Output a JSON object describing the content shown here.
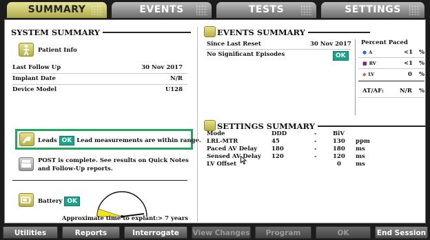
{
  "tabs": [
    {
      "label": "SUMMARY",
      "active": true
    },
    {
      "label": "EVENTS",
      "active": false
    },
    {
      "label": "TESTS",
      "active": false
    },
    {
      "label": "SETTINGS",
      "active": false
    }
  ],
  "system_summary": {
    "title": "SYSTEM SUMMARY",
    "patient_info": "Patient Info",
    "fields": [
      {
        "label": "Last Follow Up",
        "value": "30 Nov 2017"
      },
      {
        "label": "Implant Date",
        "value": "N/R"
      },
      {
        "label": "Device Model",
        "value": "U128"
      }
    ],
    "leads": {
      "label": "Leads",
      "status": "OK",
      "message": "Lead measurements are within range."
    },
    "post": {
      "line1": "POST is complete. See results on Quick Notes",
      "line2": "and Follow-Up reports."
    },
    "battery": {
      "label": "Battery",
      "status": "OK",
      "explant_label": "Approximate time to explant:",
      "explant_value": "> 7 years",
      "gauge_level": 0.1
    }
  },
  "events_summary": {
    "title": "EVENTS SUMMARY",
    "since_label": "Since Last Reset",
    "since_value": "30 Nov 2017",
    "episodes": "No Significant Episodes",
    "episodes_status": "OK",
    "percent_paced": {
      "title": "Percent Paced",
      "rows": [
        {
          "chamber": "A",
          "value": "<1",
          "unit": "%",
          "color": "#2a6fd6",
          "symbol": "●"
        },
        {
          "chamber": "RV",
          "value": "<1",
          "unit": "%",
          "color": "#8e1b6e",
          "symbol": "■"
        },
        {
          "chamber": "LV",
          "value": "0",
          "unit": "%",
          "color": "#e0552a",
          "symbol": "◆"
        }
      ],
      "af_label": "AT/AF:",
      "af_value": "N/R",
      "af_unit": "%"
    }
  },
  "settings_summary": {
    "title": "SETTINGS SUMMARY",
    "rows": [
      {
        "name": "Mode",
        "v1": "DDD",
        "dash": "-",
        "v2": "BiV",
        "unit": ""
      },
      {
        "name": "LRL-MTR",
        "v1": "45",
        "dash": "-",
        "v2": "130",
        "unit": "ppm"
      },
      {
        "name": "Paced AV Delay",
        "v1": "180",
        "dash": "-",
        "v2": "180",
        "unit": "ms"
      },
      {
        "name": "Sensed AV Delay",
        "v1": "120",
        "dash": "-",
        "v2": "120",
        "unit": "ms"
      },
      {
        "name": "LV Offset",
        "v1": "",
        "dash": "",
        "v2": "0",
        "unit": "ms"
      }
    ]
  },
  "buttons": [
    {
      "label": "Utilities",
      "enabled": true
    },
    {
      "label": "Reports",
      "enabled": true
    },
    {
      "label": "Interrogate",
      "enabled": true
    },
    {
      "label": "View Changes",
      "enabled": false
    },
    {
      "label": "Program",
      "enabled": false
    },
    {
      "label": "OK",
      "enabled": false
    },
    {
      "label": "End Session",
      "enabled": true
    }
  ]
}
